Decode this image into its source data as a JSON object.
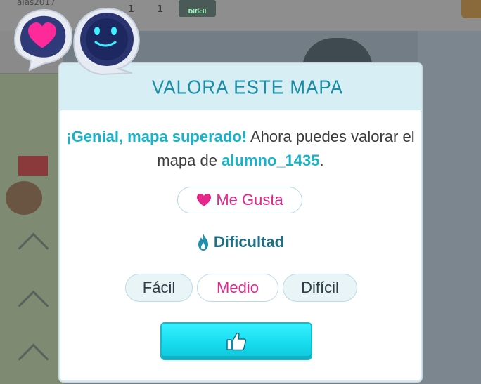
{
  "background": {
    "username_fragment": "aias2017",
    "stat_values": [
      "1",
      "1"
    ],
    "difficulty_badge": "Difícil"
  },
  "modal": {
    "title": "VALORA ESTE MAPA",
    "message_highlight": "¡Genial, mapa superado!",
    "message_part1": " Ahora puedes valorar el mapa de ",
    "author": "alumno_1435",
    "message_end": ".",
    "like_label": "Me Gusta",
    "difficulty_label": "Dificultad",
    "difficulty_options": [
      "Fácil",
      "Medio",
      "Difícil"
    ],
    "selected_difficulty": "Medio",
    "confirm_icon": "thumbs-up-icon"
  },
  "colors": {
    "accent_cyan": "#18b3c8",
    "accent_pink": "#e6268a",
    "title_color": "#1a8ea6",
    "header_bg": "#d6eef4",
    "button_cyan": "#20e2f2"
  }
}
